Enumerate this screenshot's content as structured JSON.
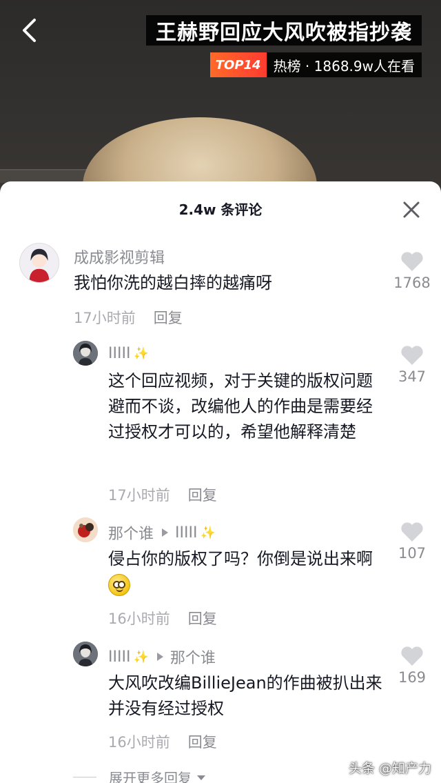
{
  "video": {
    "title": "王赫野回应大风吹被指抄袭",
    "hot_rank_badge": "TOP14",
    "hot_text": "热榜 · 1868.9w人在看"
  },
  "sheet": {
    "comment_count": "2.4w 条评论"
  },
  "comments": [
    {
      "username": "成成影视剪辑",
      "text": "我怕你洗的越白摔的越痛呀",
      "time": "17小时前",
      "reply_label": "回复",
      "likes": "1768"
    },
    {
      "username": "IIIII",
      "text": "这个回应视频，对于关键的版权问题避而不谈，改编他人的作曲是需要经过授权才可以的，希望他解释清楚",
      "time": "17小时前",
      "reply_label": "回复",
      "likes": "347"
    },
    {
      "username": "那个谁",
      "reply_to": "IIIII",
      "text": "侵占你的版权了吗？你倒是说出来啊",
      "time": "16小时前",
      "reply_label": "回复",
      "likes": "107"
    },
    {
      "username": "IIIII",
      "reply_to": "那个谁",
      "text": "大风吹改编BillieJean的作曲被扒出来并没有经过授权",
      "time": "16小时前",
      "reply_label": "回复",
      "likes": "169"
    }
  ],
  "expand_more": "展开更多回复",
  "watermark": "头条 @知产力",
  "colors": {
    "text_primary": "#161823",
    "text_secondary": "#8a8b91",
    "like_icon": "#d3d4d8",
    "hot_badge": "#ff4d2e"
  }
}
